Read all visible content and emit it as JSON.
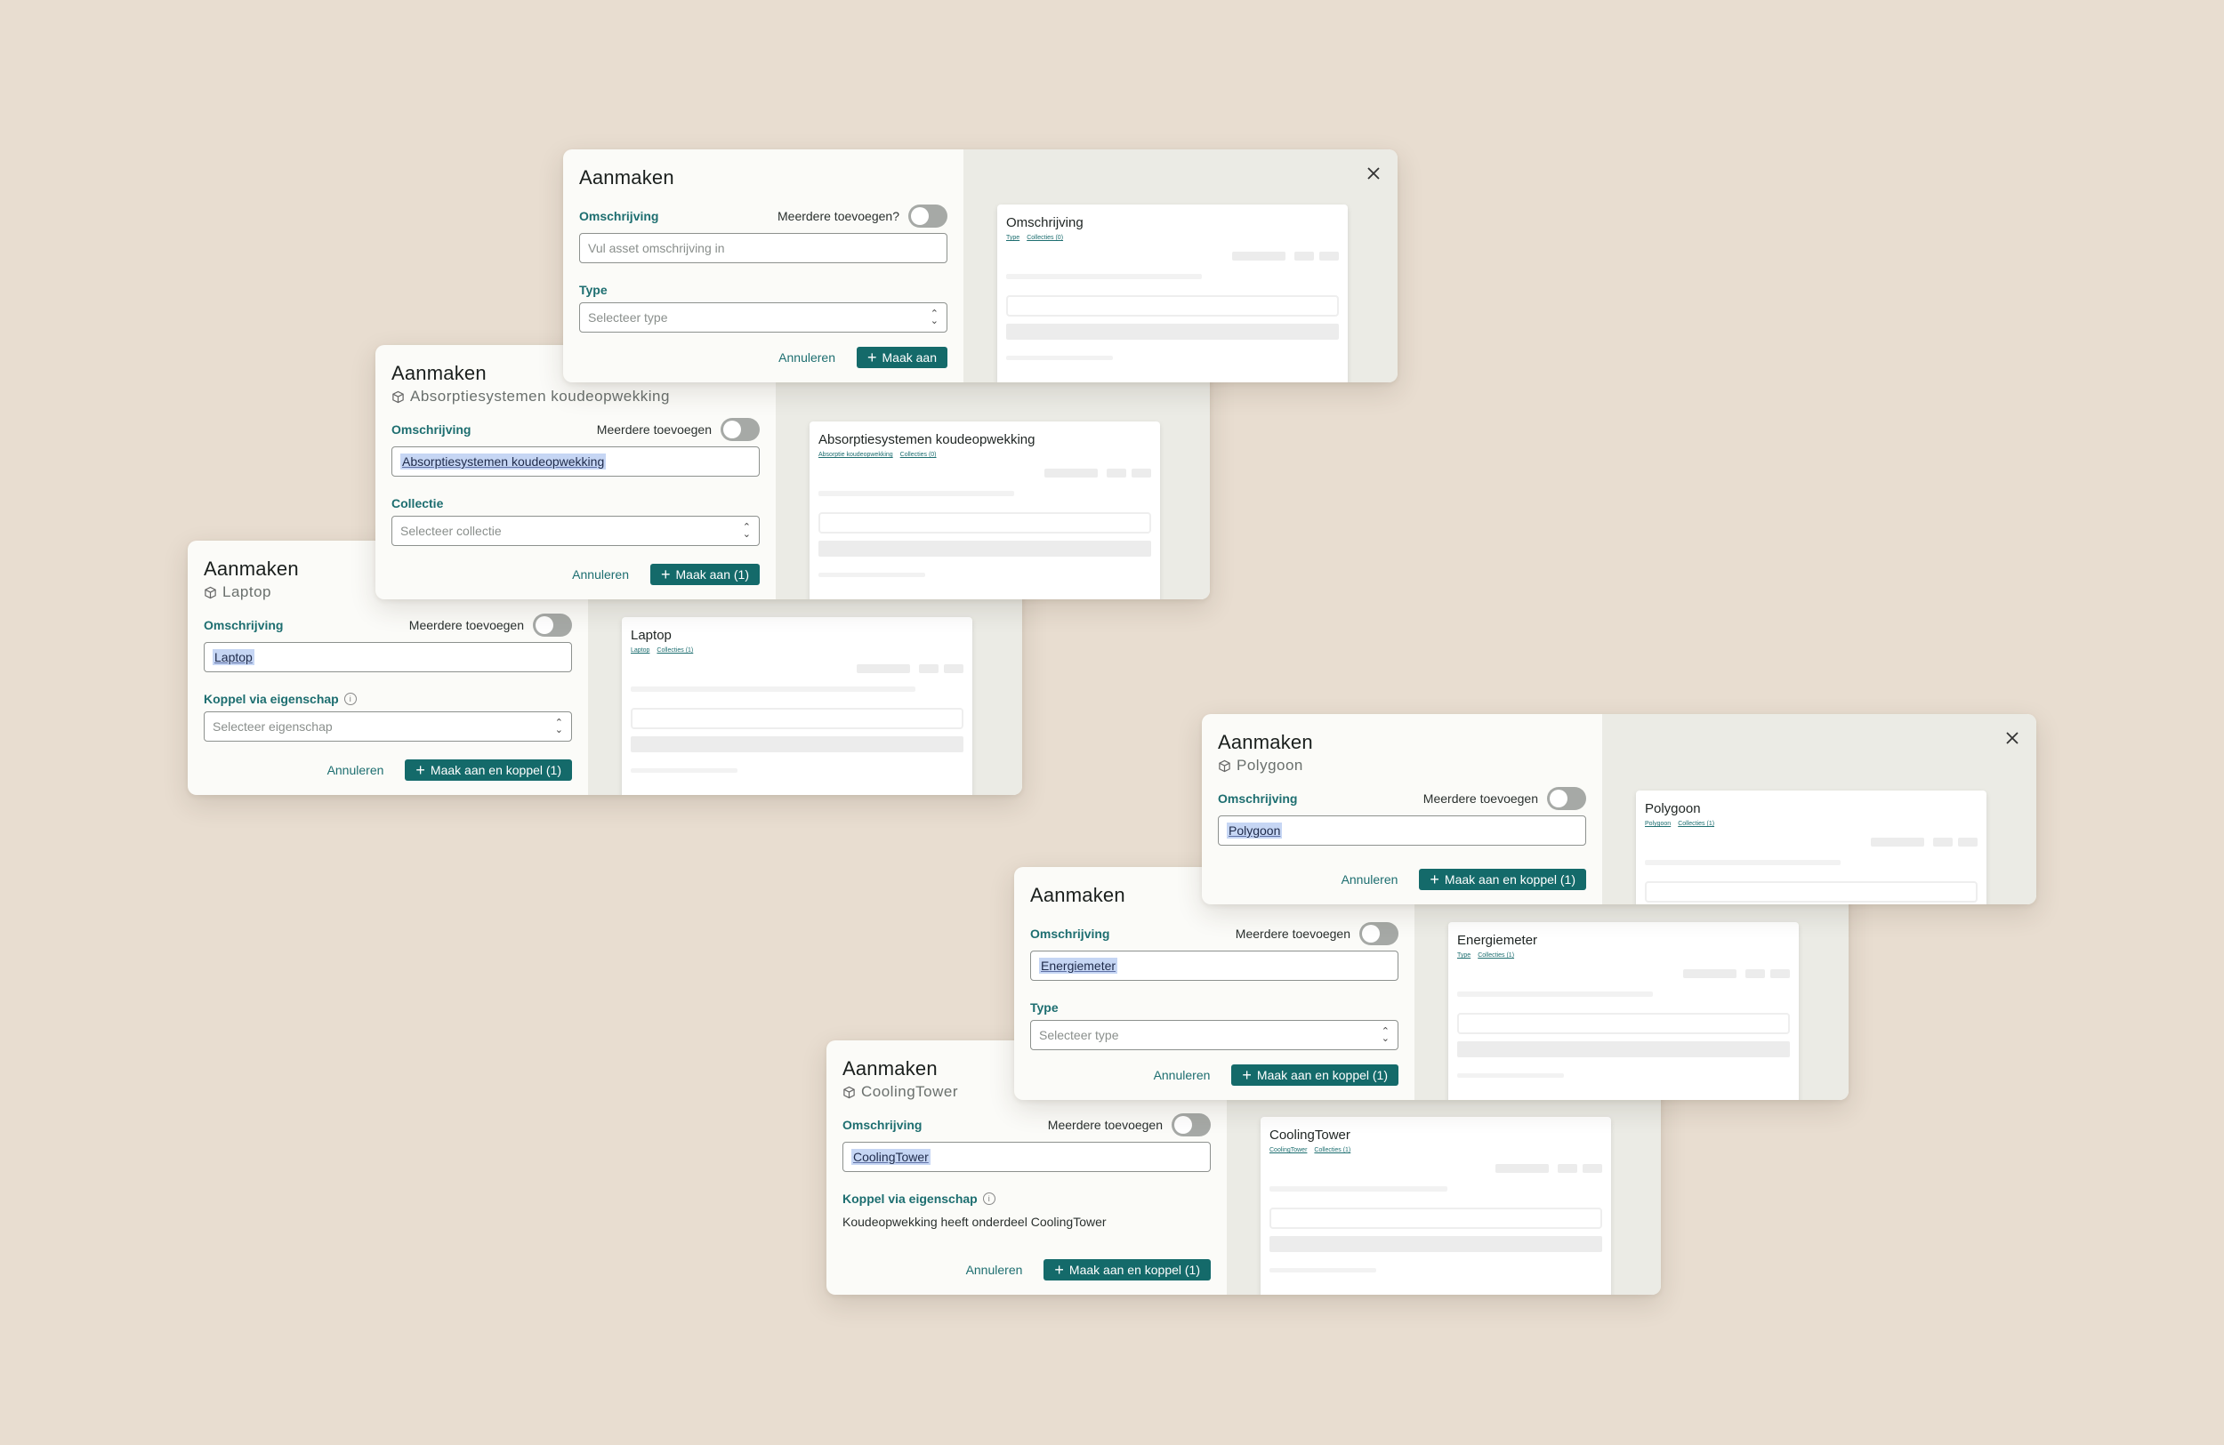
{
  "dialogs": {
    "d1": {
      "title": "Aanmaken",
      "field_label": "Omschrijving",
      "toggle_label": "Meerdere toevoegen?",
      "input_placeholder": "Vul asset omschrijving in",
      "second_label": "Type",
      "select_placeholder": "Selecteer type",
      "cancel": "Annuleren",
      "submit": "Maak aan",
      "card": {
        "title": "Omschrijving",
        "meta_type": "Type",
        "meta_collections": "Collecties (0)"
      }
    },
    "d2": {
      "title": "Aanmaken",
      "subtitle": "Absorptiesystemen koudeopwekking",
      "field_label": "Omschrijving",
      "toggle_label": "Meerdere toevoegen",
      "input_value": "Absorptiesystemen koudeopwekking",
      "second_label": "Collectie",
      "select_placeholder": "Selecteer collectie",
      "cancel": "Annuleren",
      "submit": "Maak aan (1)",
      "card": {
        "title": "Absorptiesystemen koudeopwekking",
        "meta_type": "Absorptie koudeopwekking",
        "meta_collections": "Collecties (0)"
      }
    },
    "d3": {
      "title": "Aanmaken",
      "subtitle": "Laptop",
      "field_label": "Omschrijving",
      "toggle_label": "Meerdere toevoegen",
      "input_value": "Laptop",
      "second_label": "Koppel via eigenschap",
      "select_placeholder": "Selecteer eigenschap",
      "cancel": "Annuleren",
      "submit": "Maak aan en koppel (1)",
      "card": {
        "title": "Laptop",
        "meta_type": "Laptop",
        "meta_collections": "Collecties (1)"
      }
    },
    "d4": {
      "title": "Aanmaken",
      "subtitle": "Polygoon",
      "field_label": "Omschrijving",
      "toggle_label": "Meerdere toevoegen",
      "input_value": "Polygoon",
      "cancel": "Annuleren",
      "submit": "Maak aan en koppel (1)",
      "card": {
        "title": "Polygoon",
        "meta_type": "Polygoon",
        "meta_collections": "Collecties (1)"
      }
    },
    "d5": {
      "title": "Aanmaken",
      "field_label": "Omschrijving",
      "toggle_label": "Meerdere toevoegen",
      "input_value": "Energiemeter",
      "second_label": "Type",
      "select_placeholder": "Selecteer type",
      "cancel": "Annuleren",
      "submit": "Maak aan en koppel (1)",
      "card": {
        "title": "Energiemeter",
        "meta_type": "Type",
        "meta_collections": "Collecties (1)"
      }
    },
    "d6": {
      "title": "Aanmaken",
      "subtitle": "CoolingTower",
      "field_label": "Omschrijving",
      "toggle_label": "Meerdere toevoegen",
      "input_value": "CoolingTower",
      "second_label": "Koppel via eigenschap",
      "static_text": "Koudeopwekking heeft onderdeel CoolingTower",
      "cancel": "Annuleren",
      "submit": "Maak aan en koppel (1)",
      "card": {
        "title": "CoolingTower",
        "meta_type": "CoolingTower",
        "meta_collections": "Collecties (1)"
      }
    }
  },
  "colors": {
    "accent": "#146a6a",
    "label": "#1d6e70",
    "background": "#e8ddd0",
    "selection": "#c6d6f4"
  },
  "icons": {
    "subtitle": "cube-icon",
    "close": "close-icon",
    "info": "info-icon",
    "select": "chevron-updown-icon"
  }
}
